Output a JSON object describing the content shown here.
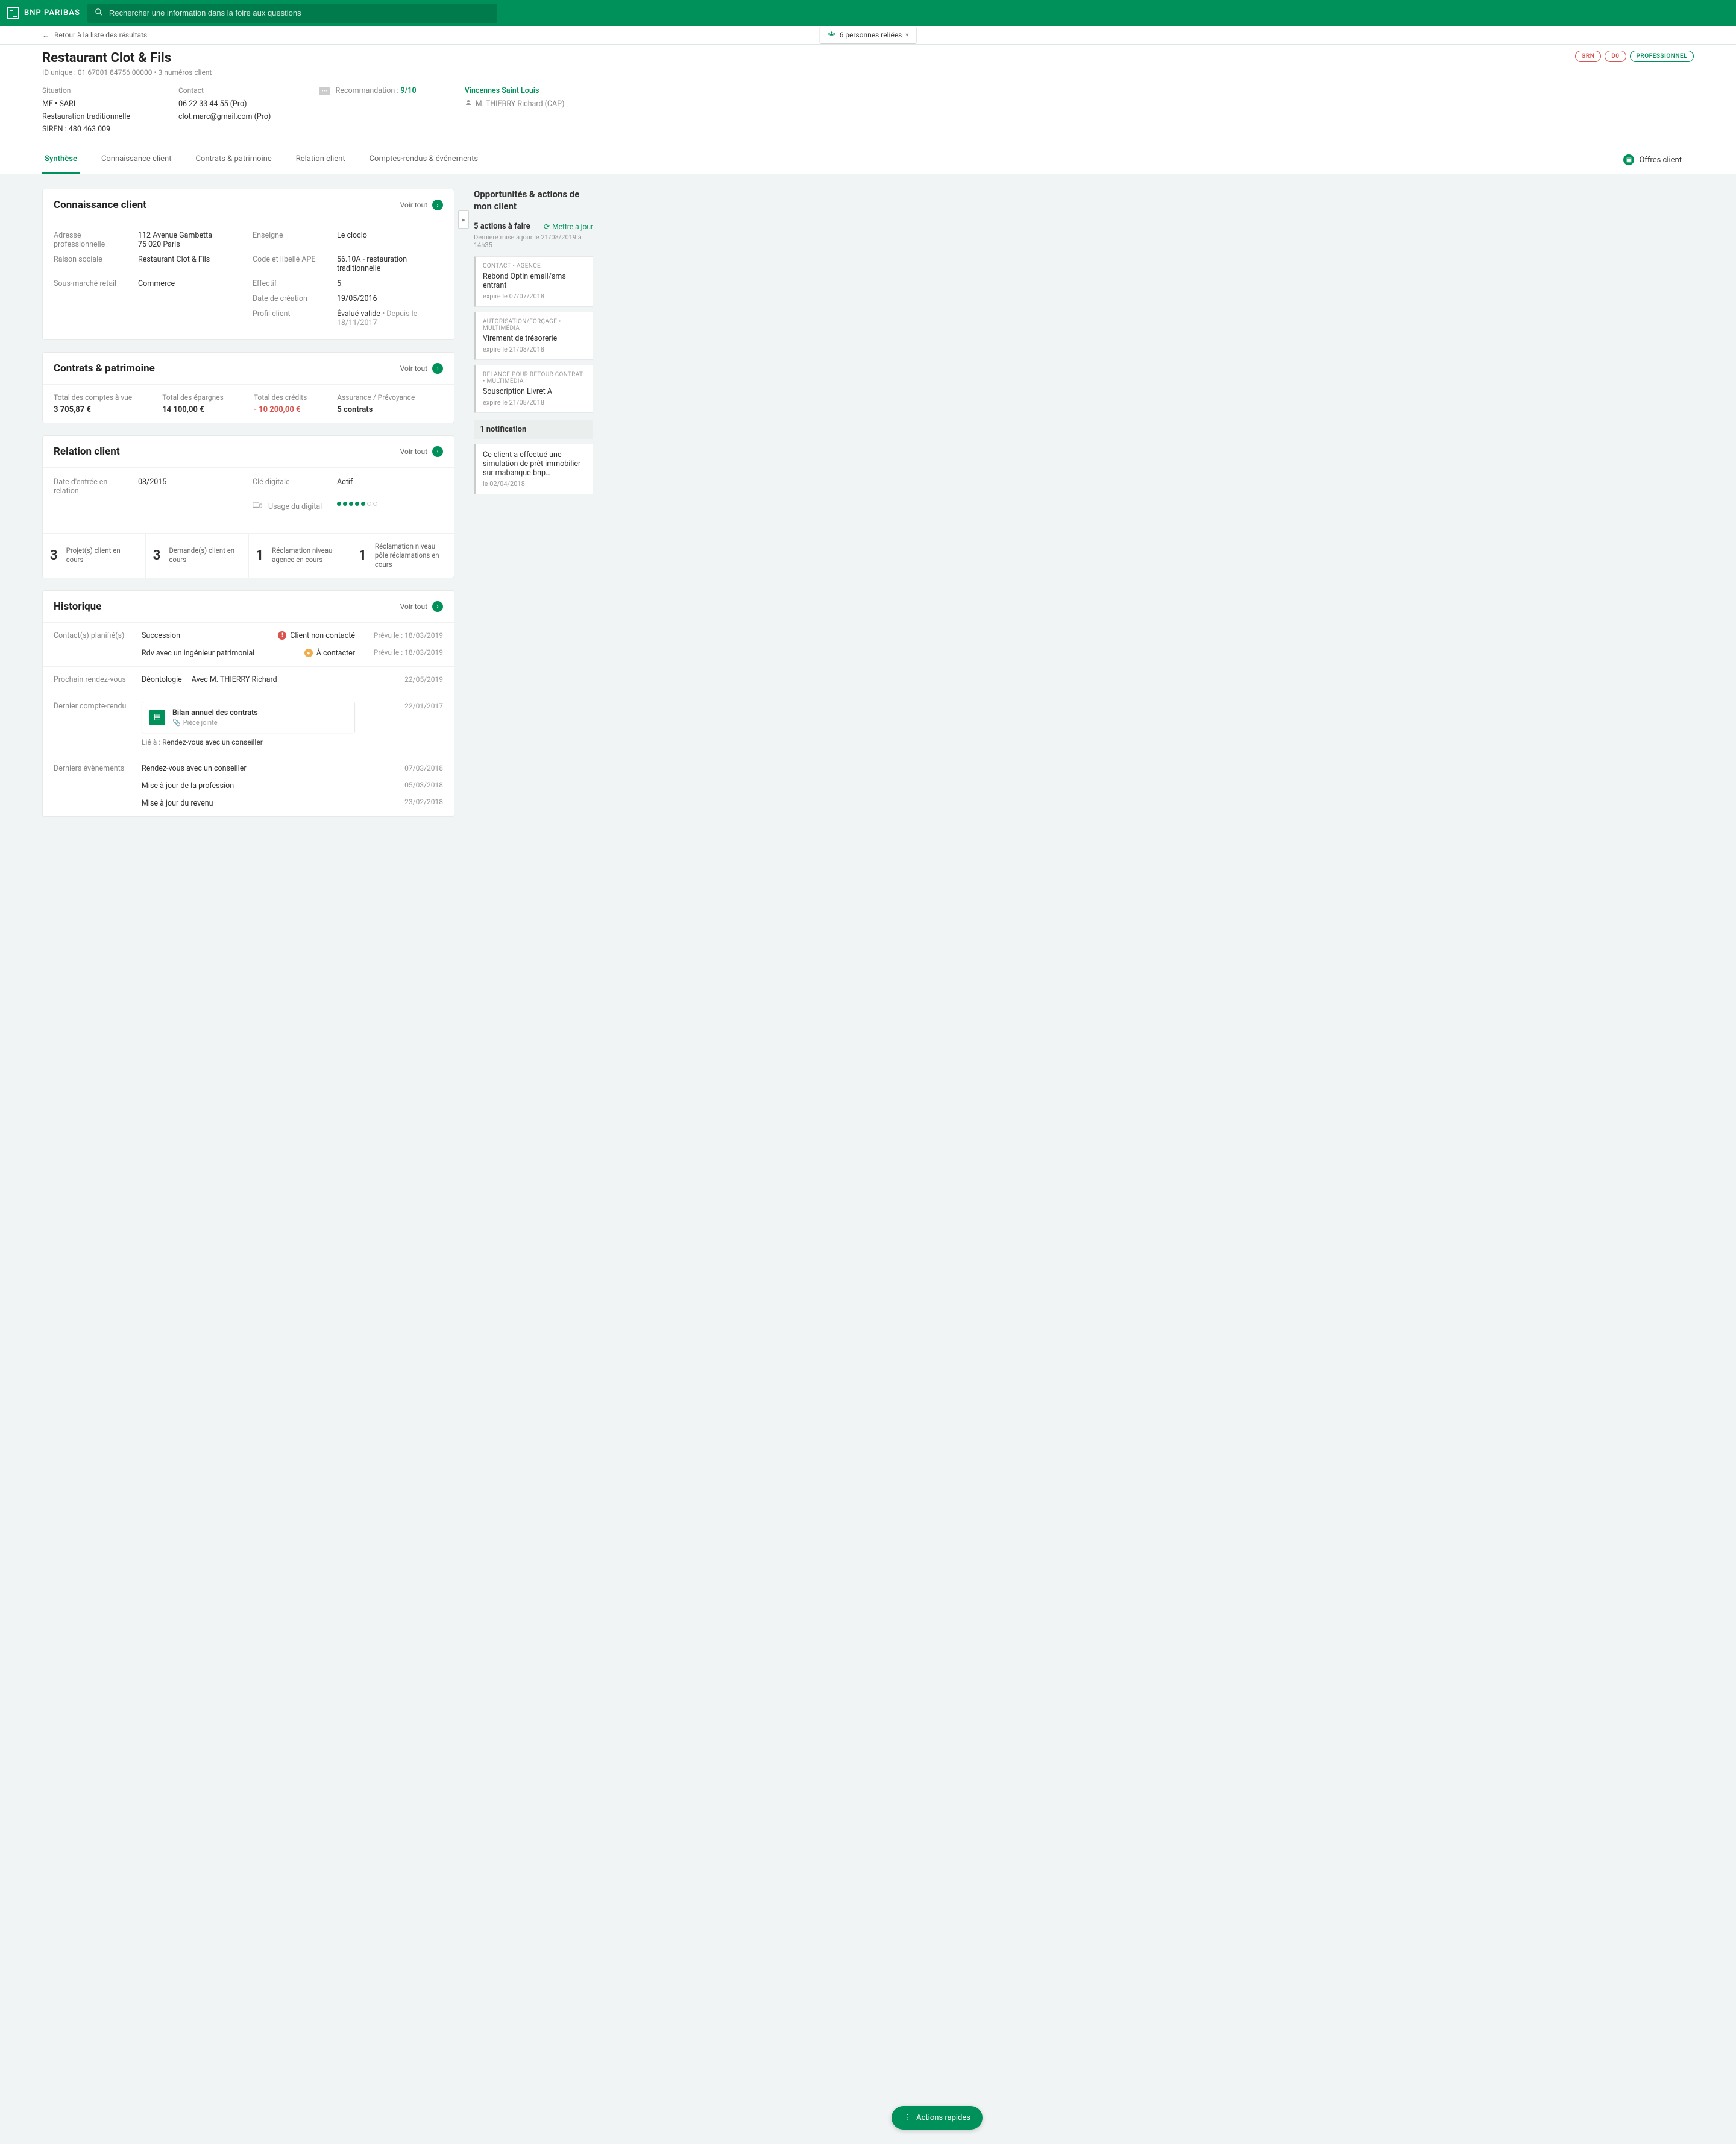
{
  "brand": "BNP PARIBAS",
  "search": {
    "placeholder": "Rechercher une information dans la foire aux questions"
  },
  "back": "Retour à la liste des résultats",
  "linked_persons": "6 personnes reliées",
  "client": {
    "name": "Restaurant Clot & Fils",
    "id": "ID unique : 01 67001 84756 00000 • 3 numéros client"
  },
  "badges": {
    "grn": "GRN",
    "d0": "D0",
    "pro": "PROFESSIONNEL"
  },
  "situation": {
    "label": "Situation",
    "type": "ME • SARL",
    "activity": "Restauration traditionnelle",
    "siren": "SIREN : 480 463 009"
  },
  "contact": {
    "label": "Contact",
    "phone": "06 22 33 44 55 (Pro)",
    "email": "clot.marc@gmail.com (Pro)"
  },
  "reco": {
    "label": "Recommandation :",
    "value": "9/10"
  },
  "agency": {
    "name": "Vincennes Saint Louis",
    "advisor": "M. THIERRY Richard (CAP)"
  },
  "tabs": [
    "Synthèse",
    "Connaissance client",
    "Contrats & patrimoine",
    "Relation client",
    "Comptes-rendus & événements"
  ],
  "offers_tab": "Offres client",
  "voir_tout": "Voir tout",
  "kc": {
    "title": "Connaissance client",
    "address_label": "Adresse professionnelle",
    "address": "112 Avenue Gambetta\n75 020 Paris",
    "raison_label": "Raison sociale",
    "raison": "Restaurant Clot & Fils",
    "sousmarche_label": "Sous-marché retail",
    "sousmarche": "Commerce",
    "enseigne_label": "Enseigne",
    "enseigne": "Le cloclo",
    "ape_label": "Code et libellé APE",
    "ape": "56.10A - restauration traditionnelle",
    "effectif_label": "Effectif",
    "effectif": "5",
    "date_label": "Date de création",
    "date": "19/05/2016",
    "profil_label": "Profil client",
    "profil": "Évalué valide",
    "profil_since": " • Depuis le 18/11/2017"
  },
  "cp": {
    "title": "Contrats & patrimoine",
    "comptes_label": "Total des comptes à vue",
    "comptes": "3 705,87 €",
    "epargne_label": "Total des épargnes",
    "epargne": "14 100,00 €",
    "credits_label": "Total des crédits",
    "credits": "- 10 200,00 €",
    "assurance_label": "Assurance / Prévoyance",
    "assurance": "5 contrats"
  },
  "rc": {
    "title": "Relation client",
    "date_label": "Date d'entrée en relation",
    "date": "08/2015",
    "cle_label": "Clé digitale",
    "cle": "Actif",
    "usage_label": "Usage du digital",
    "counters": [
      {
        "n": "3",
        "label": "Projet(s) client en cours"
      },
      {
        "n": "3",
        "label": "Demande(s) client en cours"
      },
      {
        "n": "1",
        "label": "Réclamation niveau agence en cours"
      },
      {
        "n": "1",
        "label": "Réclamation niveau pôle réclamations en cours"
      }
    ]
  },
  "hist": {
    "title": "Historique",
    "rows": {
      "contacts": {
        "label": "Contact(s) planifié(s)",
        "items": [
          {
            "title": "Succession",
            "status": "Client non contacté",
            "date": "Prévu le : 18/03/2019",
            "icon": "red"
          },
          {
            "title": "Rdv avec un ingénieur patrimonial",
            "status": "À contacter",
            "date": "Prévu le : 18/03/2019",
            "icon": "orange"
          }
        ]
      },
      "rdv": {
        "label": "Prochain rendez-vous",
        "title": "Déontologie — Avec M. THIERRY Richard",
        "date": "22/05/2019"
      },
      "cr": {
        "label": "Dernier compte-rendu",
        "attachment": {
          "title": "Bilan annuel des contrats",
          "sub": "Pièce jointe"
        },
        "linked_prefix": "Lié à : ",
        "linked": "Rendez-vous avec un conseiller",
        "date": "22/01/2017"
      },
      "events": {
        "label": "Derniers évènements",
        "items": [
          {
            "title": "Rendez-vous avec un conseiller",
            "date": "07/03/2018"
          },
          {
            "title": "Mise à jour de la profession",
            "date": "05/03/2018"
          },
          {
            "title": "Mise à jour du revenu",
            "date": "23/02/2018"
          }
        ]
      }
    }
  },
  "side": {
    "title": "Opportunités & actions de mon client",
    "count": "5 actions à faire",
    "refresh": "Mettre à jour",
    "updated": "Dernière mise à jour le 21/08/2019 à 14h35",
    "actions": [
      {
        "cat": "CONTACT • AGENCE",
        "title": "Rebond Optin email/sms entrant",
        "expire": "expire le 07/07/2018"
      },
      {
        "cat": "AUTORISATION/FORÇAGE • MULTIMÉDIA",
        "title": "Virement de trésorerie",
        "expire": "expire le 21/08/2018"
      },
      {
        "cat": "RELANCE POUR RETOUR CONTRAT • MULTIMÉDIA",
        "title": "Souscription Livret A",
        "expire": "expire le 21/08/2018"
      }
    ],
    "notif_head": "1 notification",
    "notif": {
      "title": "Ce client a effectué une simulation de prêt immobilier sur mabanque.bnp…",
      "date": "le 02/04/2018"
    }
  },
  "fab": "Actions rapides"
}
